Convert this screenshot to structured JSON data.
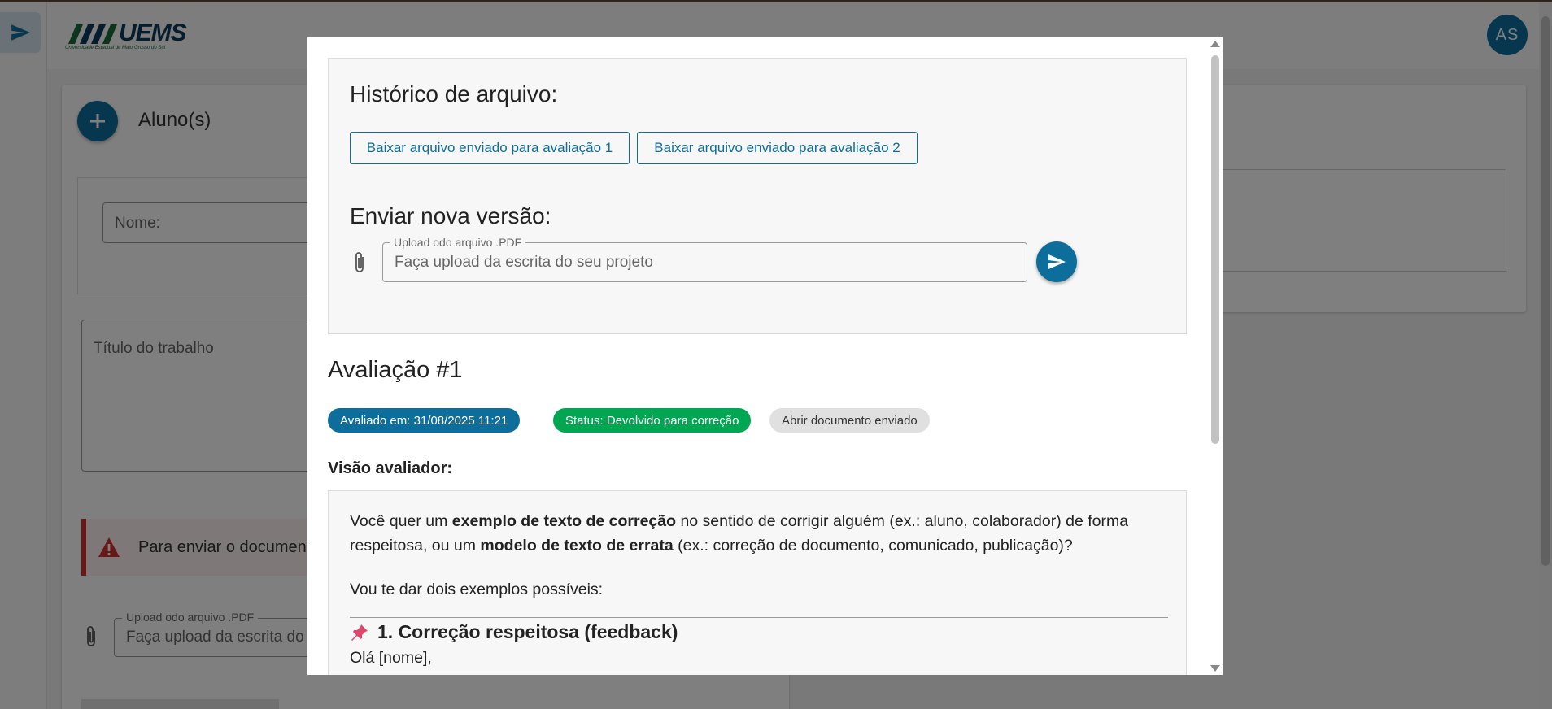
{
  "app": {
    "logo_text": "UEMS",
    "logo_subtitle": "Universidade Estadual de Mato Grosso do Sul",
    "avatar_initials": "AS"
  },
  "background": {
    "students_label": "Aluno(s)",
    "name_placeholder": "Nome:",
    "title_placeholder": "Título do trabalho",
    "alert_text": "Para enviar o documento",
    "upload_label": "Upload odo arquivo .PDF",
    "upload_placeholder": "Faça upload da escrita do seu projeto"
  },
  "modal": {
    "history_title": "Histórico de arquivo:",
    "download_buttons": [
      "Baixar arquivo enviado para avaliação 1",
      "Baixar arquivo enviado para avaliação 2"
    ],
    "send_title": "Enviar nova versão:",
    "upload_label": "Upload odo arquivo .PDF",
    "upload_placeholder": "Faça upload da escrita do seu projeto",
    "evaluation_title": "Avaliação #1",
    "chips": {
      "evaluated_at": "Avaliado em: 31/08/2025 11:21",
      "status": "Status: Devolvido para correção",
      "open_document": "Abrir documento enviado"
    },
    "reviewer_view_label": "Visão avaliador:",
    "reviewer_text": {
      "p1_a": "Você quer um ",
      "p1_b": "exemplo de texto de correção",
      "p1_c": " no sentido de corrigir alguém (ex.: aluno, colaborador) de forma respeitosa, ou um ",
      "p1_d": "modelo de texto de errata",
      "p1_e": " (ex.: correção de documento, comunicado, publicação)?",
      "p2": "Vou te dar dois exemplos possíveis:",
      "section1_title": "1. Correção respeitosa (feedback)",
      "greeting": "Olá [nome],"
    }
  },
  "colors": {
    "primary": "#0d6e9c",
    "success": "#00a651",
    "danger": "#d32f2f",
    "chip_gray": "#e0e0e0"
  },
  "icons": {
    "sidebar": "send-icon",
    "fab": "plus-icon",
    "alert": "warning-icon",
    "upload": "paperclip-icon",
    "send": "send-icon",
    "section": "pushpin-icon"
  }
}
